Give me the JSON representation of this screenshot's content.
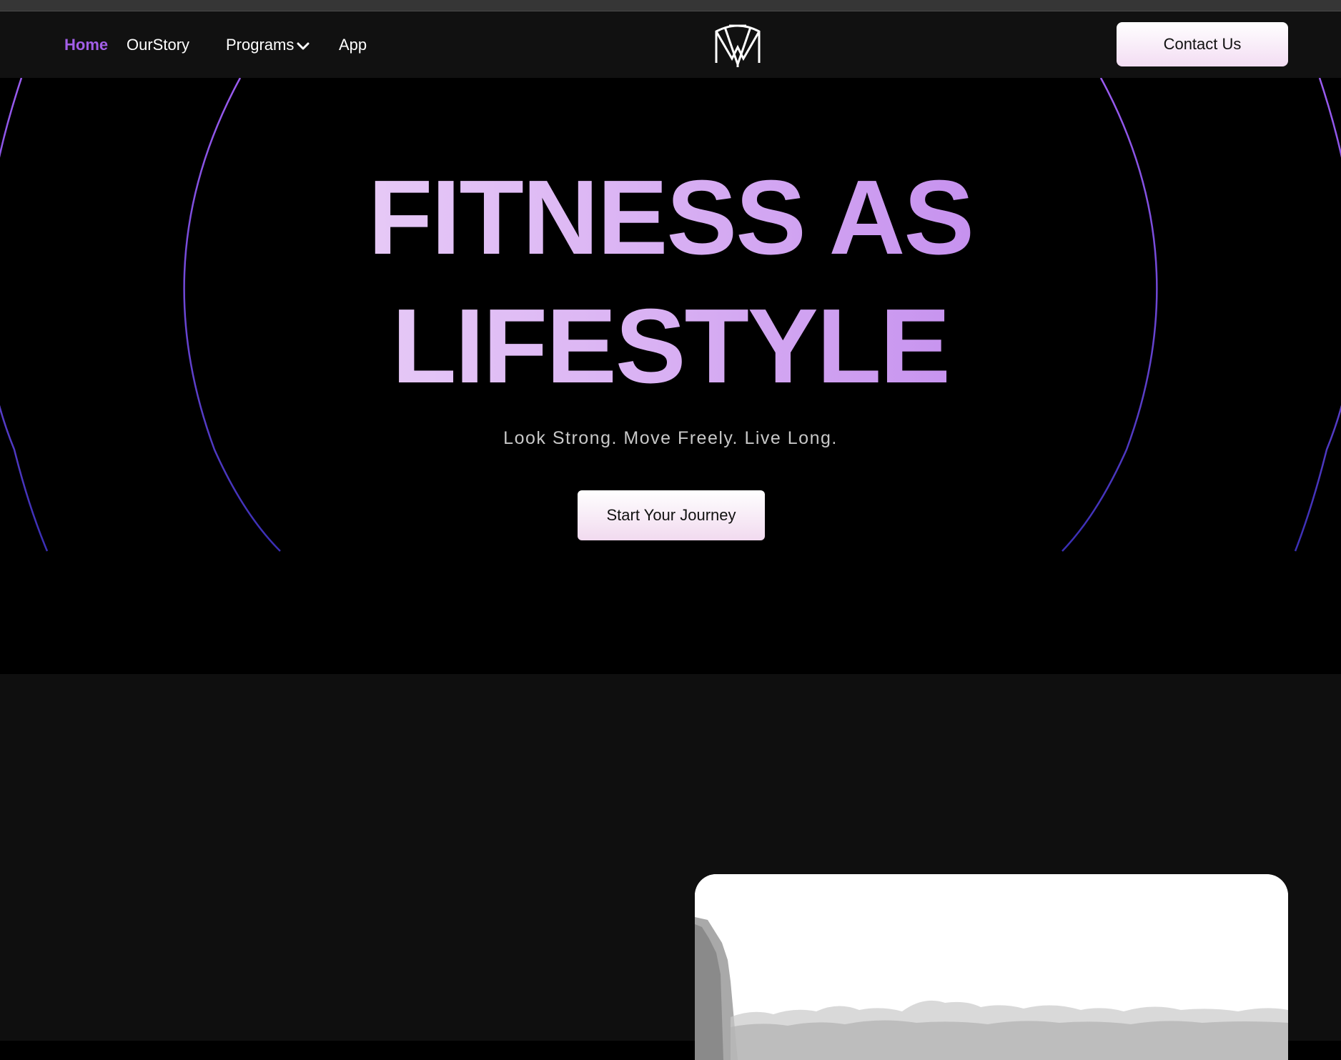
{
  "nav": {
    "links": [
      {
        "label": "Home",
        "active": true
      },
      {
        "label": "OurStory",
        "active": false
      },
      {
        "label": "Programs",
        "active": false,
        "has_dropdown": true
      },
      {
        "label": "App",
        "active": false
      }
    ],
    "logo_icon": "mtm-monogram-logo",
    "contact_label": "Contact Us"
  },
  "hero": {
    "title_line1": "FITNESS AS",
    "title_line2": "LIFESTYLE",
    "tagline": "Look Strong. Move Freely. Live Long.",
    "cta_label": "Start Your Journey"
  },
  "colors": {
    "accent": "#a35fe8",
    "nav_bg": "#111111",
    "hero_bg": "#000000",
    "section_bg": "#0f0f0f",
    "arc_top": "#9b5cf0",
    "arc_bottom": "#3a2fb5"
  },
  "icons": [
    "chevron-down-icon",
    "mtm-monogram-logo"
  ]
}
